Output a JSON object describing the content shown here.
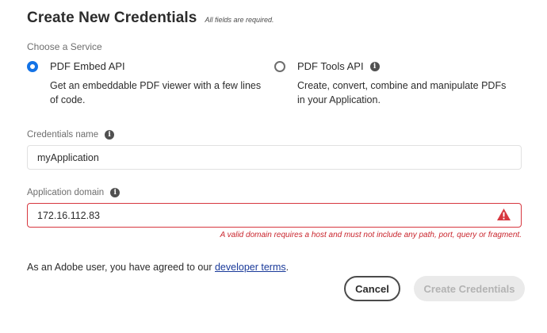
{
  "dialog": {
    "title": "Create New Credentials",
    "required_note": "All fields are required."
  },
  "service": {
    "section_label": "Choose a Service",
    "options": [
      {
        "label": "PDF Embed API",
        "description": "Get an embeddable PDF viewer with a few lines of code.",
        "selected": true
      },
      {
        "label": "PDF Tools API",
        "description": "Create, convert, combine and manipulate PDFs in your Application.",
        "selected": false,
        "icon": "info-icon"
      }
    ]
  },
  "credentials_name": {
    "label": "Credentials name",
    "value": "myApplication",
    "icon": "info-icon"
  },
  "app_domain": {
    "label": "Application domain",
    "value": "172.16.112.83",
    "icon": "info-icon",
    "error_icon": "warning-triangle-icon",
    "error_message": "A valid domain requires a host and must not include any path, port, query or fragment."
  },
  "terms": {
    "prefix": "As an Adobe user, you have agreed to our ",
    "link_label": "developer terms",
    "suffix": "."
  },
  "actions": {
    "cancel_label": "Cancel",
    "create_label": "Create Credentials"
  },
  "colors": {
    "accent": "#1473e6",
    "error": "#d7373f",
    "disabled_bg": "#eaeaea",
    "disabled_text": "#b3b3b3",
    "link": "#1a3a9a"
  }
}
